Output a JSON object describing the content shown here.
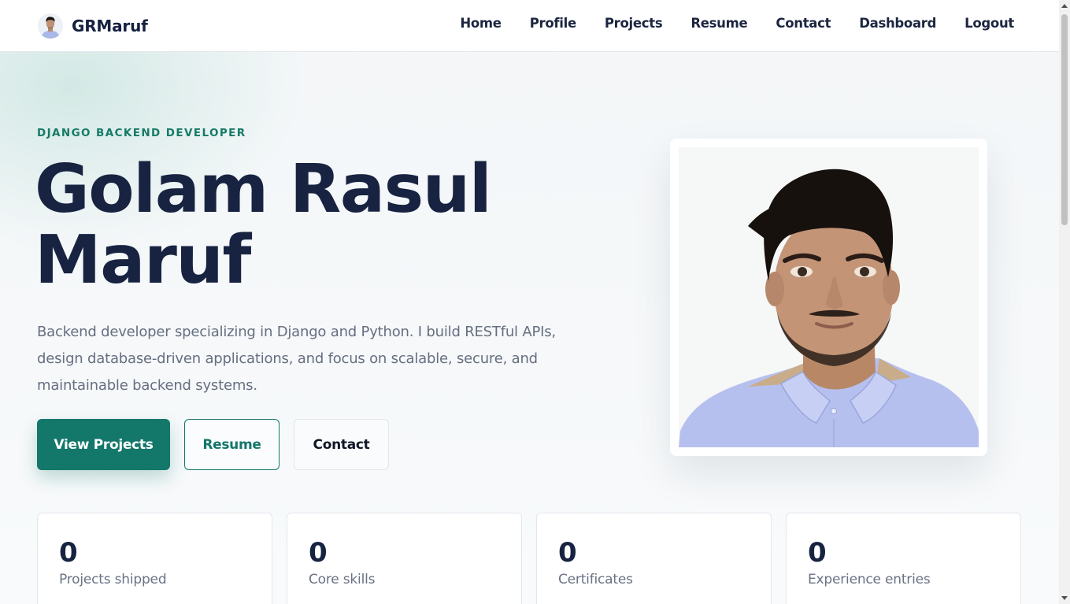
{
  "header": {
    "brand": "GRMaruf",
    "nav": [
      {
        "label": "Home"
      },
      {
        "label": "Profile"
      },
      {
        "label": "Projects"
      },
      {
        "label": "Resume"
      },
      {
        "label": "Contact"
      },
      {
        "label": "Dashboard"
      },
      {
        "label": "Logout"
      }
    ]
  },
  "hero": {
    "eyebrow": "DJANGO BACKEND DEVELOPER",
    "title_line1": "Golam Rasul",
    "title_line2": "Maruf",
    "description": "Backend developer specializing in Django and Python. I build RESTful APIs, design database-driven applications, and focus on scalable, secure, and maintainable backend systems.",
    "buttons": {
      "primary": "View Projects",
      "resume": "Resume",
      "contact": "Contact"
    }
  },
  "stats": [
    {
      "value": "0",
      "label": "Projects shipped"
    },
    {
      "value": "0",
      "label": "Core skills"
    },
    {
      "value": "0",
      "label": "Certificates"
    },
    {
      "value": "0",
      "label": "Experience entries"
    }
  ],
  "colors": {
    "accent": "#13776a",
    "heading": "#172341",
    "muted": "#666e80"
  }
}
